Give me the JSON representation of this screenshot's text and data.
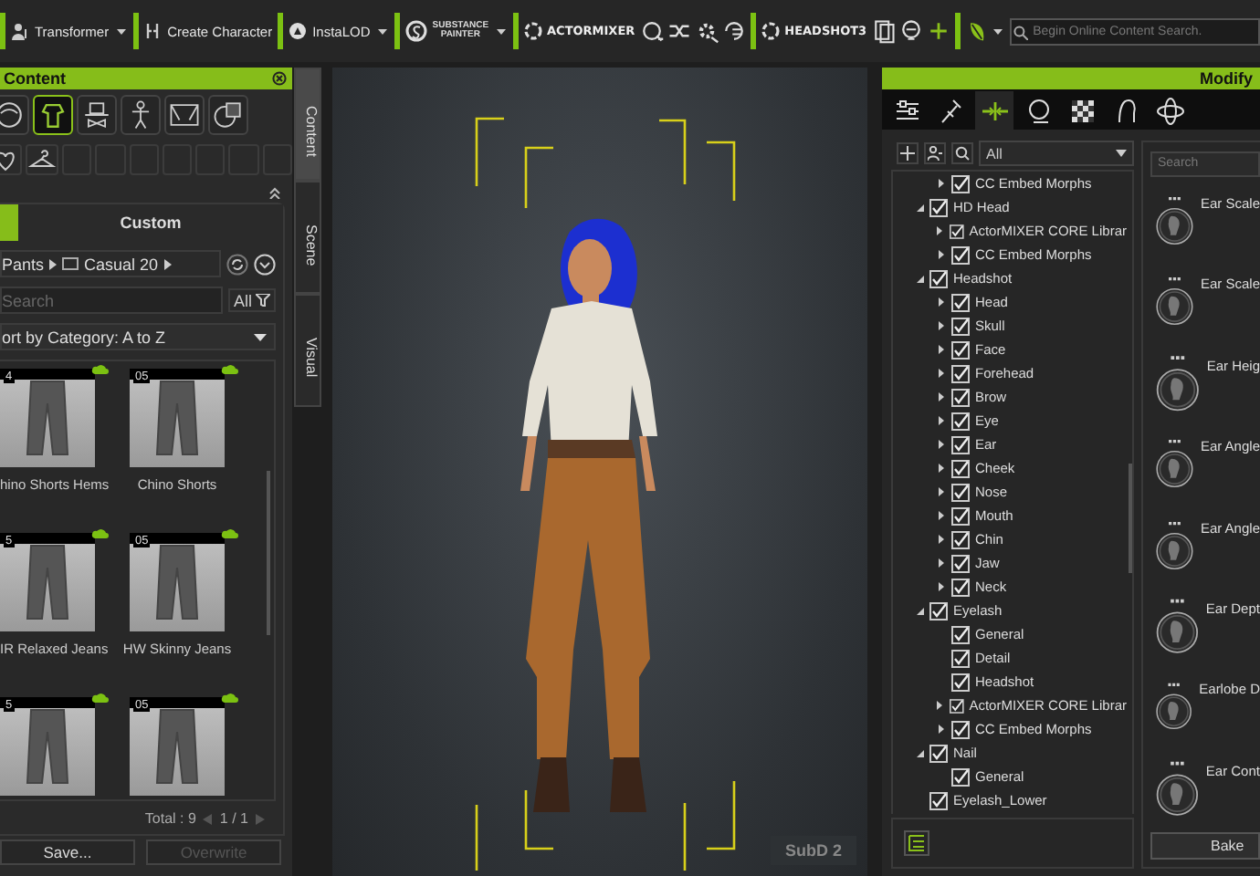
{
  "toolbar": {
    "groups": [
      {
        "items": [
          {
            "kind": "button",
            "label": "Transformer",
            "menu": true
          }
        ]
      },
      {
        "items": [
          {
            "kind": "button",
            "label": "Create Character",
            "menu": false
          }
        ]
      },
      {
        "items": [
          {
            "kind": "button",
            "label": "InstaLOD",
            "menu": true
          }
        ]
      },
      {
        "items": [
          {
            "kind": "stacked",
            "lines": [
              "SUBSTANCE",
              "PAINTER"
            ],
            "menu": true
          }
        ]
      },
      {
        "items": [
          {
            "kind": "logo",
            "label": "ACTORMIXER",
            "menu": false
          },
          {
            "kind": "icon",
            "menu": false
          },
          {
            "kind": "icon",
            "menu": false
          },
          {
            "kind": "icon",
            "menu": false
          },
          {
            "kind": "icon",
            "menu": false
          }
        ]
      },
      {
        "items": [
          {
            "kind": "logo",
            "label": "HEADSHOT3",
            "menu": false
          },
          {
            "kind": "icon",
            "menu": false
          },
          {
            "kind": "icon",
            "menu": false
          },
          {
            "kind": "icon",
            "menu": false
          }
        ]
      },
      {
        "items": [
          {
            "kind": "icon",
            "menu": true
          }
        ]
      }
    ],
    "search": {
      "placeholder": "Begin Online Content Search."
    }
  },
  "content_panel": {
    "title": "Content",
    "category_tabs": [
      {
        "selected": false
      },
      {
        "selected": true
      },
      {
        "selected": false
      },
      {
        "selected": false
      },
      {
        "selected": false
      },
      {
        "selected": false
      }
    ],
    "source_tabs": [
      {
        "selected": true
      },
      {
        "label": "Custom",
        "selected": false
      }
    ],
    "breadcrumb": [
      "Pants",
      "Casual 20"
    ],
    "search": {
      "placeholder": "Search",
      "filter": "All"
    },
    "sort": "ort by Category: A to Z",
    "items": [
      {
        "number": "4",
        "name": "hino Shorts Hems"
      },
      {
        "number": "05",
        "name": "Chino Shorts"
      },
      {
        "number": "5",
        "name": "IR Relaxed Jeans"
      },
      {
        "number": "05",
        "name": "HW Skinny Jeans"
      },
      {
        "number": "5"
      },
      {
        "number": "05"
      }
    ],
    "total": "Total : 9",
    "page": "1 / 1",
    "buttons": [
      {
        "label": "Save...",
        "disabled": false
      },
      {
        "label": "Overwrite",
        "disabled": true
      }
    ]
  },
  "side_tabs": [
    {
      "label": "Content",
      "selected": true
    },
    {
      "label": "Scene",
      "selected": false
    },
    {
      "label": "Visual",
      "selected": false
    }
  ],
  "viewport": {
    "badge": "SubD 2"
  },
  "modify_panel": {
    "title": "Modify",
    "tabs": [
      {
        "selected": false
      },
      {
        "selected": false
      },
      {
        "selected": true
      },
      {
        "selected": false
      },
      {
        "selected": false
      },
      {
        "selected": false
      },
      {
        "selected": false
      }
    ],
    "filter": "All",
    "tree": {
      "cut_children": [
        {
          "label": "CC Embed Morphs",
          "checked": true,
          "kind": "branch",
          "expanded": false
        }
      ],
      "nodes": [
        {
          "label": "HD Head",
          "checked": true,
          "kind": "branch",
          "expanded": true,
          "children": [
            {
              "label": "ActorMIXER CORE Librar",
              "checked": true,
              "kind": "branch",
              "expanded": false
            },
            {
              "label": "CC Embed Morphs",
              "checked": true,
              "kind": "branch",
              "expanded": false
            }
          ]
        },
        {
          "label": "Headshot",
          "checked": true,
          "kind": "branch",
          "expanded": true,
          "children": [
            {
              "label": "Head",
              "checked": true,
              "kind": "branch",
              "expanded": false
            },
            {
              "label": "Skull",
              "checked": true,
              "kind": "branch",
              "expanded": false
            },
            {
              "label": "Face",
              "checked": true,
              "kind": "branch",
              "expanded": false
            },
            {
              "label": "Forehead",
              "checked": true,
              "kind": "branch",
              "expanded": false
            },
            {
              "label": "Brow",
              "checked": true,
              "kind": "branch",
              "expanded": false
            },
            {
              "label": "Eye",
              "checked": true,
              "kind": "branch",
              "expanded": false
            },
            {
              "label": "Ear",
              "checked": true,
              "kind": "branch",
              "expanded": false
            },
            {
              "label": "Cheek",
              "checked": true,
              "kind": "branch",
              "expanded": false
            },
            {
              "label": "Nose",
              "checked": true,
              "kind": "branch",
              "expanded": false
            },
            {
              "label": "Mouth",
              "checked": true,
              "kind": "branch",
              "expanded": false
            },
            {
              "label": "Chin",
              "checked": true,
              "kind": "branch",
              "expanded": false
            },
            {
              "label": "Jaw",
              "checked": true,
              "kind": "branch",
              "expanded": false
            },
            {
              "label": "Neck",
              "checked": true,
              "kind": "branch",
              "expanded": false
            }
          ]
        },
        {
          "label": "Eyelash",
          "checked": true,
          "kind": "branch",
          "expanded": true,
          "children": [
            {
              "label": "General",
              "checked": true,
              "kind": "leaf"
            },
            {
              "label": "Detail",
              "checked": true,
              "kind": "leaf"
            },
            {
              "label": "Headshot",
              "checked": true,
              "kind": "leaf"
            },
            {
              "label": "ActorMIXER CORE Librar",
              "checked": true,
              "kind": "branch",
              "expanded": false
            },
            {
              "label": "CC Embed Morphs",
              "checked": true,
              "kind": "branch",
              "expanded": false
            }
          ]
        },
        {
          "label": "Nail",
          "checked": true,
          "kind": "branch",
          "expanded": true,
          "children": [
            {
              "label": "General",
              "checked": true,
              "kind": "leaf"
            }
          ]
        },
        {
          "label": "Eyelash_Lower",
          "checked": true,
          "kind": "leaf"
        }
      ]
    },
    "search": {
      "placeholder": "Search"
    },
    "sliders": [
      {
        "label": "Ear Scale"
      },
      {
        "label": "Ear Scale"
      },
      {
        "label": "Ear Heig"
      },
      {
        "label": "Ear Angle"
      },
      {
        "label": "Ear Angle"
      },
      {
        "label": "Ear Dept"
      },
      {
        "label": "Earlobe D"
      },
      {
        "label": "Ear Cont"
      }
    ],
    "bake_button": "Bake"
  }
}
